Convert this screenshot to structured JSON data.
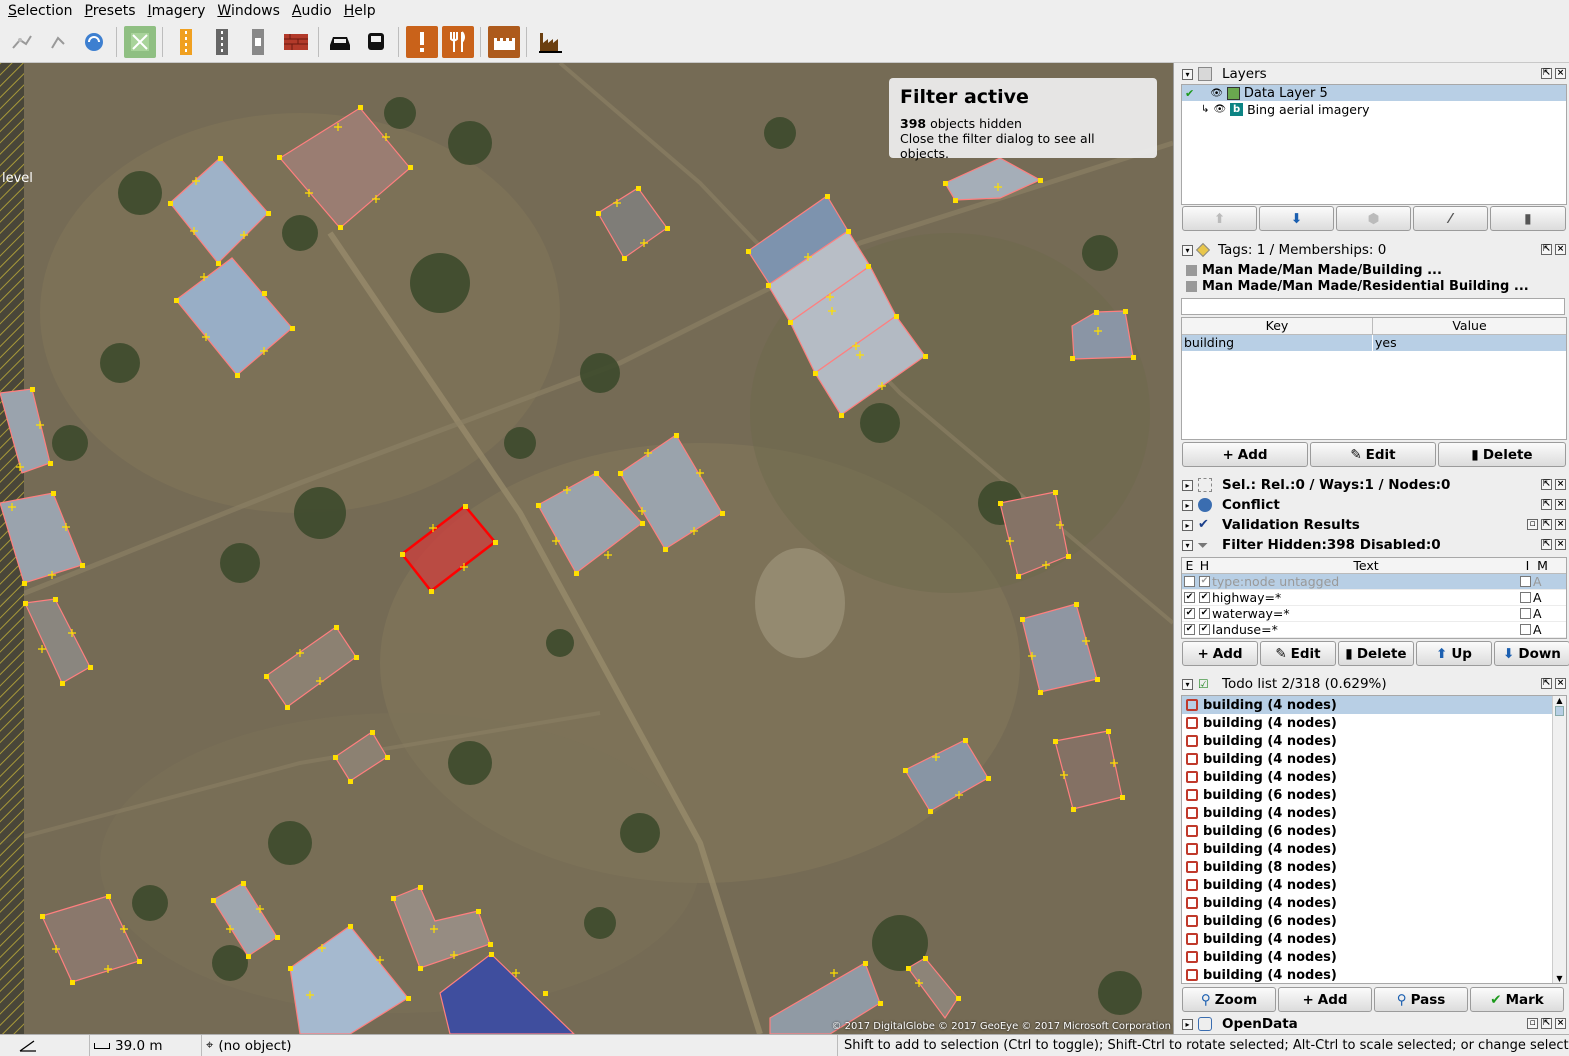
{
  "menu": [
    "Selection",
    "Presets",
    "Imagery",
    "Windows",
    "Audio",
    "Help"
  ],
  "toolbar_icons": [
    "wireframe-icon",
    "undo-icon",
    "redo-icon",
    "map-paint-icon",
    "road-icon",
    "track-icon",
    "path-icon",
    "wall-icon",
    "car-icon",
    "bus-icon",
    "warning-icon",
    "restaurant-icon",
    "castle-icon",
    "factory-icon"
  ],
  "map": {
    "level_label": "level",
    "filter_popup": {
      "title": "Filter active",
      "count": "398",
      "hidden_text": " objects hidden",
      "line2": "Close the filter dialog to see all objects."
    },
    "attribution": "© 2017 DigitalGlobe © 2017 GeoEye © 2017 Microsoft Corporation"
  },
  "layers": {
    "title": "Layers",
    "items": [
      {
        "name": "Data Layer 5",
        "active": true
      },
      {
        "name": "Bing aerial imagery",
        "active": false
      }
    ]
  },
  "tags": {
    "title": "Tags: 1 / Memberships: 0",
    "presets": [
      "Man Made/Man Made/Building ...",
      "Man Made/Man Made/Residential Building ..."
    ],
    "headers": {
      "key": "Key",
      "value": "Value"
    },
    "rows": [
      {
        "key": "building",
        "value": "yes"
      }
    ],
    "buttons": {
      "add": "Add",
      "edit": "Edit",
      "delete": "Delete"
    }
  },
  "sel_panel": "Sel.: Rel.:0 / Ways:1 / Nodes:0",
  "conflict_panel": "Conflict",
  "validation_panel": "Validation Results",
  "filter": {
    "title": "Filter Hidden:398 Disabled:0",
    "headers": {
      "e": "E",
      "h": "H",
      "text": "Text",
      "i": "I",
      "m": "M"
    },
    "rows": [
      {
        "text": "type:node untagged",
        "enabled": false,
        "mode": "A"
      },
      {
        "text": "highway=*",
        "enabled": true,
        "mode": "A"
      },
      {
        "text": "waterway=*",
        "enabled": true,
        "mode": "A"
      },
      {
        "text": "landuse=*",
        "enabled": true,
        "mode": "A"
      }
    ],
    "buttons": {
      "add": "Add",
      "edit": "Edit",
      "delete": "Delete",
      "up": "Up",
      "down": "Down"
    }
  },
  "todo": {
    "title": "Todo list 2/318 (0.629%)",
    "items": [
      "building (4 nodes)",
      "building (4 nodes)",
      "building (4 nodes)",
      "building (4 nodes)",
      "building (4 nodes)",
      "building (6 nodes)",
      "building (4 nodes)",
      "building (6 nodes)",
      "building (4 nodes)",
      "building (8 nodes)",
      "building (4 nodes)",
      "building (4 nodes)",
      "building (6 nodes)",
      "building (4 nodes)",
      "building (4 nodes)",
      "building (4 nodes)"
    ],
    "buttons": {
      "zoom": "Zoom",
      "add": "Add",
      "pass": "Pass",
      "mark": "Mark"
    }
  },
  "opendata_panel": "OpenData",
  "status": {
    "distance": "39.0 m",
    "object": "(no object)",
    "hint": "Shift to add to selection (Ctrl to toggle); Shift-Ctrl to rotate selected; Alt-Ctrl to scale selected; or change selection"
  }
}
